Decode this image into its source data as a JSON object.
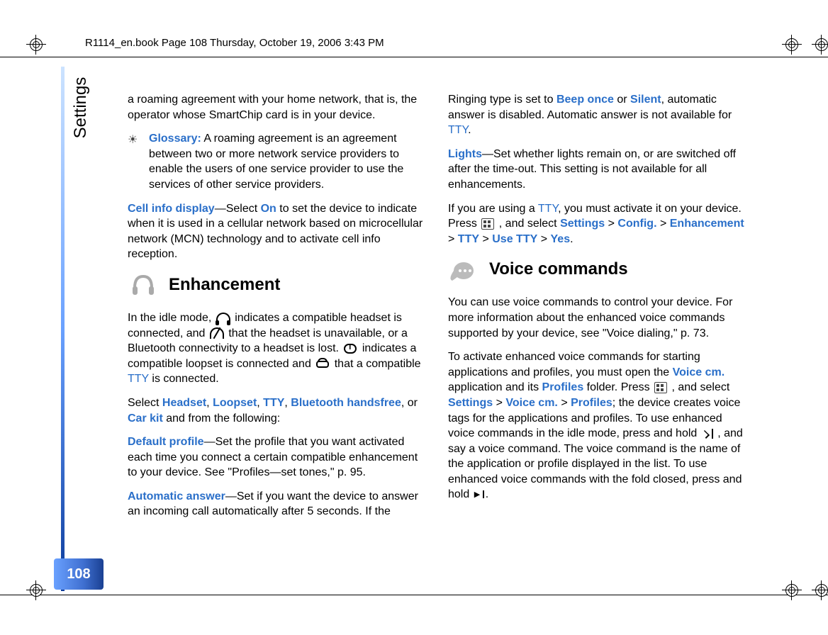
{
  "header": "R1114_en.book  Page 108  Thursday, October 19, 2006  3:43 PM",
  "sidebar": {
    "tab": "Settings",
    "page": "108"
  },
  "left": {
    "p1": "a roaming agreement with your home network, that is, the operator whose SmartChip card is in your device.",
    "glossary_label": "Glossary:",
    "glossary_text": " A roaming agreement is an agreement between two or more network service providers to enable the users of one service provider to use the services of other service providers.",
    "cell_info_label": "Cell info display",
    "cell_info_rest1": "—Select ",
    "cell_info_on": "On",
    "cell_info_rest2": " to set the device to indicate when it is used in a cellular network based on microcellular network (MCN) technology and to activate cell info reception.",
    "section_enh": "Enhancement",
    "idle1": "In the idle mode, ",
    "idle2": " indicates a compatible headset is connected, and  ",
    "idle3": " that the headset is unavailable, or a Bluetooth connectivity to a headset is lost. ",
    "idle4": " indicates a compatible loopset is connected and  ",
    "idle5": " that a compatible ",
    "idle_tty": "TTY",
    "idle6": " is connected.",
    "sel1": "Select ",
    "sel_headset": "Headset",
    "sel_loopset": "Loopset",
    "sel_tty": "TTY",
    "sel_bt": "Bluetooth handsfree",
    "sel_or": ", or ",
    "sel_car": "Car kit",
    "sel_rest": " and from the following:",
    "defprof_label": "Default profile",
    "defprof_rest": "—Set the profile that you want activated each time you connect a certain compatible enhancement to your device. See \"Profiles—set tones,\" p. 95.",
    "autoans_label": "Automatic answer",
    "autoans_rest": "—Set if you want the device to answer an incoming call automatically after 5 seconds. If the"
  },
  "right": {
    "p1a": "Ringing type is set to ",
    "beep": "Beep once",
    "p1b": " or ",
    "silent": "Silent",
    "p1c": ", automatic answer is disabled. Automatic answer is not available for ",
    "tty1": "TTY",
    "lights_label": "Lights",
    "lights_rest": "—Set whether lights remain on, or are switched off after the time-out.  This setting is not available for all enhancements.",
    "tty_use1": "If you are using a ",
    "tty2": "TTY",
    "tty_use2": ", you must activate it on your device. Press  ",
    "tty_use3": " , and select ",
    "settings": "Settings",
    "config": "Config.",
    "enh": "Enhancement",
    "tty3": "TTY",
    "usetty": "Use TTY",
    "yes": "Yes",
    "section_voice": "Voice commands",
    "vc1": "You can use voice commands to control your device. For more information about the enhanced voice commands supported by your device, see \"Voice dialing,\" p. 73.",
    "vc2a": "To activate enhanced voice commands for starting applications and profiles, you must open the ",
    "voicecm": "Voice cm.",
    "vc2b": " application and its ",
    "profiles": "Profiles",
    "vc2c": " folder. Press  ",
    "vc2d": " , and select ",
    "settings2": "Settings",
    "voicecm2": "Voice cm.",
    "profiles2": "Profiles",
    "vc2e": "; the device creates voice tags for the applications and profiles. To use enhanced voice commands in the idle mode, press and hold  ",
    "vc2f": " , and say a voice command. The voice command is the name of the application or profile displayed in the list. To use enhanced voice commands with the fold closed, press and hold "
  }
}
